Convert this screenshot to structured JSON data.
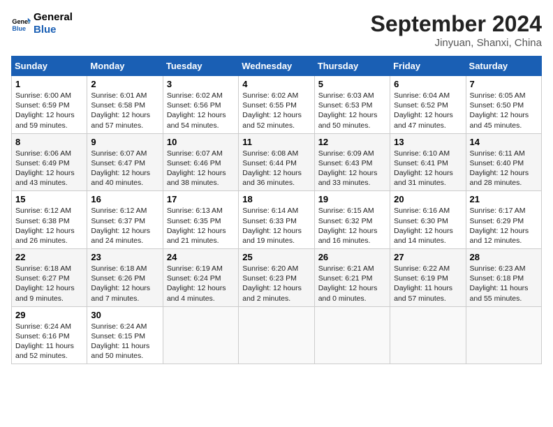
{
  "header": {
    "logo_line1": "General",
    "logo_line2": "Blue",
    "month": "September 2024",
    "location": "Jinyuan, Shanxi, China"
  },
  "weekdays": [
    "Sunday",
    "Monday",
    "Tuesday",
    "Wednesday",
    "Thursday",
    "Friday",
    "Saturday"
  ],
  "weeks": [
    [
      {
        "day": "1",
        "info": "Sunrise: 6:00 AM\nSunset: 6:59 PM\nDaylight: 12 hours\nand 59 minutes."
      },
      {
        "day": "2",
        "info": "Sunrise: 6:01 AM\nSunset: 6:58 PM\nDaylight: 12 hours\nand 57 minutes."
      },
      {
        "day": "3",
        "info": "Sunrise: 6:02 AM\nSunset: 6:56 PM\nDaylight: 12 hours\nand 54 minutes."
      },
      {
        "day": "4",
        "info": "Sunrise: 6:02 AM\nSunset: 6:55 PM\nDaylight: 12 hours\nand 52 minutes."
      },
      {
        "day": "5",
        "info": "Sunrise: 6:03 AM\nSunset: 6:53 PM\nDaylight: 12 hours\nand 50 minutes."
      },
      {
        "day": "6",
        "info": "Sunrise: 6:04 AM\nSunset: 6:52 PM\nDaylight: 12 hours\nand 47 minutes."
      },
      {
        "day": "7",
        "info": "Sunrise: 6:05 AM\nSunset: 6:50 PM\nDaylight: 12 hours\nand 45 minutes."
      }
    ],
    [
      {
        "day": "8",
        "info": "Sunrise: 6:06 AM\nSunset: 6:49 PM\nDaylight: 12 hours\nand 43 minutes."
      },
      {
        "day": "9",
        "info": "Sunrise: 6:07 AM\nSunset: 6:47 PM\nDaylight: 12 hours\nand 40 minutes."
      },
      {
        "day": "10",
        "info": "Sunrise: 6:07 AM\nSunset: 6:46 PM\nDaylight: 12 hours\nand 38 minutes."
      },
      {
        "day": "11",
        "info": "Sunrise: 6:08 AM\nSunset: 6:44 PM\nDaylight: 12 hours\nand 36 minutes."
      },
      {
        "day": "12",
        "info": "Sunrise: 6:09 AM\nSunset: 6:43 PM\nDaylight: 12 hours\nand 33 minutes."
      },
      {
        "day": "13",
        "info": "Sunrise: 6:10 AM\nSunset: 6:41 PM\nDaylight: 12 hours\nand 31 minutes."
      },
      {
        "day": "14",
        "info": "Sunrise: 6:11 AM\nSunset: 6:40 PM\nDaylight: 12 hours\nand 28 minutes."
      }
    ],
    [
      {
        "day": "15",
        "info": "Sunrise: 6:12 AM\nSunset: 6:38 PM\nDaylight: 12 hours\nand 26 minutes."
      },
      {
        "day": "16",
        "info": "Sunrise: 6:12 AM\nSunset: 6:37 PM\nDaylight: 12 hours\nand 24 minutes."
      },
      {
        "day": "17",
        "info": "Sunrise: 6:13 AM\nSunset: 6:35 PM\nDaylight: 12 hours\nand 21 minutes."
      },
      {
        "day": "18",
        "info": "Sunrise: 6:14 AM\nSunset: 6:33 PM\nDaylight: 12 hours\nand 19 minutes."
      },
      {
        "day": "19",
        "info": "Sunrise: 6:15 AM\nSunset: 6:32 PM\nDaylight: 12 hours\nand 16 minutes."
      },
      {
        "day": "20",
        "info": "Sunrise: 6:16 AM\nSunset: 6:30 PM\nDaylight: 12 hours\nand 14 minutes."
      },
      {
        "day": "21",
        "info": "Sunrise: 6:17 AM\nSunset: 6:29 PM\nDaylight: 12 hours\nand 12 minutes."
      }
    ],
    [
      {
        "day": "22",
        "info": "Sunrise: 6:18 AM\nSunset: 6:27 PM\nDaylight: 12 hours\nand 9 minutes."
      },
      {
        "day": "23",
        "info": "Sunrise: 6:18 AM\nSunset: 6:26 PM\nDaylight: 12 hours\nand 7 minutes."
      },
      {
        "day": "24",
        "info": "Sunrise: 6:19 AM\nSunset: 6:24 PM\nDaylight: 12 hours\nand 4 minutes."
      },
      {
        "day": "25",
        "info": "Sunrise: 6:20 AM\nSunset: 6:23 PM\nDaylight: 12 hours\nand 2 minutes."
      },
      {
        "day": "26",
        "info": "Sunrise: 6:21 AM\nSunset: 6:21 PM\nDaylight: 12 hours\nand 0 minutes."
      },
      {
        "day": "27",
        "info": "Sunrise: 6:22 AM\nSunset: 6:19 PM\nDaylight: 11 hours\nand 57 minutes."
      },
      {
        "day": "28",
        "info": "Sunrise: 6:23 AM\nSunset: 6:18 PM\nDaylight: 11 hours\nand 55 minutes."
      }
    ],
    [
      {
        "day": "29",
        "info": "Sunrise: 6:24 AM\nSunset: 6:16 PM\nDaylight: 11 hours\nand 52 minutes."
      },
      {
        "day": "30",
        "info": "Sunrise: 6:24 AM\nSunset: 6:15 PM\nDaylight: 11 hours\nand 50 minutes."
      },
      {
        "day": "",
        "info": ""
      },
      {
        "day": "",
        "info": ""
      },
      {
        "day": "",
        "info": ""
      },
      {
        "day": "",
        "info": ""
      },
      {
        "day": "",
        "info": ""
      }
    ]
  ]
}
